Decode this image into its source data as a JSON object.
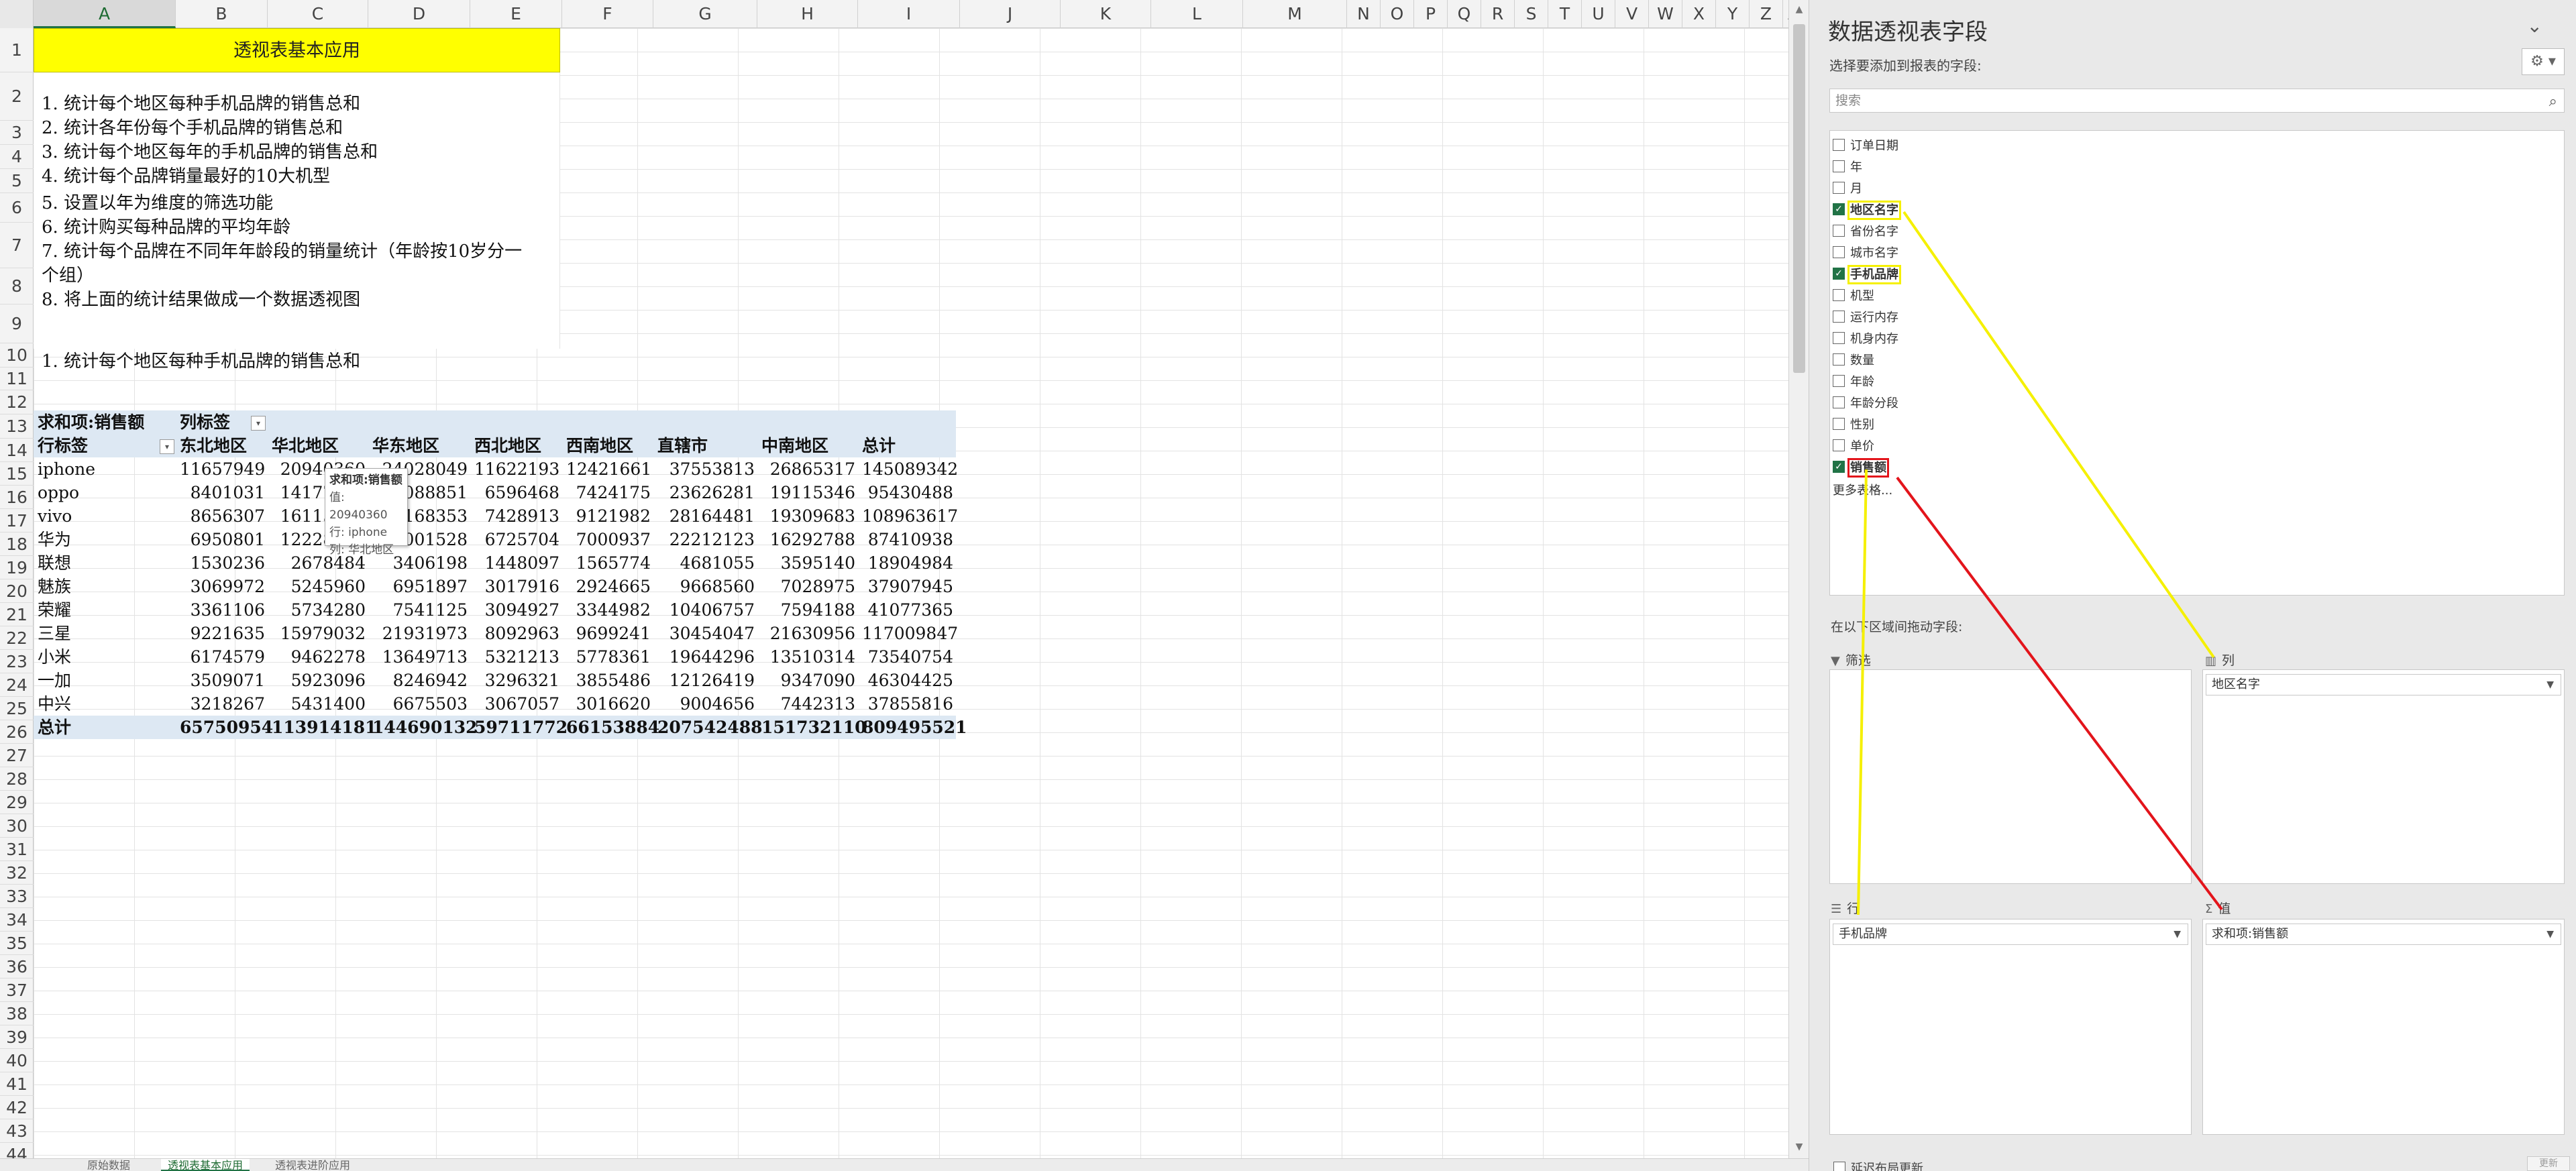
{
  "columns": [
    "A",
    "B",
    "C",
    "D",
    "E",
    "F",
    "G",
    "H",
    "I",
    "J",
    "K",
    "L",
    "M",
    "N",
    "O",
    "P",
    "Q",
    "R",
    "S",
    "T",
    "U",
    "V",
    "W",
    "X",
    "Y",
    "Z",
    "AA"
  ],
  "row_count": 44,
  "sheet": {
    "title": "透视表基本应用",
    "instructions": [
      "1.  统计每个地区每种手机品牌的销售总和",
      "2.  统计各年份每个手机品牌的销售总和",
      "3.  统计每个地区每年的手机品牌的销售总和",
      "4.  统计每个品牌销量最好的10大机型",
      "5.  设置以年为维度的筛选功能",
      "6.  统计购买每种品牌的平均年龄",
      "7.  统计每个品牌在不同年年龄段的销量统计（年龄按10岁分一",
      "个组）",
      "8.  将上面的统计结果做成一个数据透视图"
    ],
    "section_label": "1.  统计每个地区每种手机品牌的销售总和"
  },
  "pivot": {
    "value_label": "求和项:销售额",
    "col_label": "列标签",
    "row_label": "行标签",
    "headers": [
      "东北地区",
      "华北地区",
      "华东地区",
      "西北地区",
      "西南地区",
      "直辖市",
      "中南地区",
      "总计"
    ],
    "rows": [
      {
        "brand": "iphone",
        "values": [
          "11657949",
          "20940360",
          "24028049",
          "11622193",
          "12421661",
          "37553813",
          "26865317",
          "145089342"
        ]
      },
      {
        "brand": "oppo",
        "values": [
          "8401031",
          "14177032",
          "18088851",
          "6596468",
          "7424175",
          "23626281",
          "19115346",
          "95430488"
        ]
      },
      {
        "brand": "vivo",
        "values": [
          "8656307",
          "16115689",
          "18168353",
          "7428913",
          "9121982",
          "28164481",
          "19309683",
          "108963617"
        ]
      },
      {
        "brand": "华为",
        "values": [
          "6950801",
          "12228877",
          "16001528",
          "6725704",
          "7000937",
          "22212123",
          "16292788",
          "87410938"
        ]
      },
      {
        "brand": "联想",
        "values": [
          "1530236",
          "2678484",
          "3406198",
          "1448097",
          "1565774",
          "4681055",
          "3595140",
          "18904984"
        ]
      },
      {
        "brand": "魅族",
        "values": [
          "3069972",
          "5245960",
          "6951897",
          "3017916",
          "2924665",
          "9668560",
          "7028975",
          "37907945"
        ]
      },
      {
        "brand": "荣耀",
        "values": [
          "3361106",
          "5734280",
          "7541125",
          "3094927",
          "3344982",
          "10406757",
          "7594188",
          "41077365"
        ]
      },
      {
        "brand": "三星",
        "values": [
          "9221635",
          "15979032",
          "21931973",
          "8092963",
          "9699241",
          "30454047",
          "21630956",
          "117009847"
        ]
      },
      {
        "brand": "小米",
        "values": [
          "6174579",
          "9462278",
          "13649713",
          "5321213",
          "5778361",
          "19644296",
          "13510314",
          "73540754"
        ]
      },
      {
        "brand": "一加",
        "values": [
          "3509071",
          "5923096",
          "8246942",
          "3296321",
          "3855486",
          "12126419",
          "9347090",
          "46304425"
        ]
      },
      {
        "brand": "中兴",
        "values": [
          "3218267",
          "5431400",
          "6675503",
          "3067057",
          "3016620",
          "9004656",
          "7442313",
          "37855816"
        ]
      }
    ],
    "total_label": "总计",
    "totals": [
      "65750954",
      "113914181",
      "144690132",
      "59711772",
      "66153884",
      "207542488",
      "151732110",
      "809495521"
    ]
  },
  "tooltip": {
    "title": "求和项:销售额",
    "value": "值: 20940360",
    "row": "行: iphone",
    "col": "列: 华北地区"
  },
  "tabs": [
    "原始数据",
    "透视表基本应用",
    "透视表进阶应用"
  ],
  "pane": {
    "title": "数据透视表字段",
    "subtitle": "选择要添加到报表的字段:",
    "search_placeholder": "搜索",
    "fields": [
      {
        "label": "订单日期",
        "checked": false
      },
      {
        "label": "年",
        "checked": false
      },
      {
        "label": "月",
        "checked": false
      },
      {
        "label": "地区名字",
        "checked": true
      },
      {
        "label": "省份名字",
        "checked": false
      },
      {
        "label": "城市名字",
        "checked": false
      },
      {
        "label": "手机品牌",
        "checked": true
      },
      {
        "label": "机型",
        "checked": false
      },
      {
        "label": "运行内存",
        "checked": false
      },
      {
        "label": "机身内存",
        "checked": false
      },
      {
        "label": "数量",
        "checked": false
      },
      {
        "label": "年龄",
        "checked": false
      },
      {
        "label": "年龄分段",
        "checked": false
      },
      {
        "label": "性别",
        "checked": false
      },
      {
        "label": "单价",
        "checked": false
      },
      {
        "label": "销售额",
        "checked": true
      }
    ],
    "more_tables": "更多表格...",
    "drag_hint": "在以下区域间拖动字段:",
    "filter_label": "筛选",
    "columns_label": "列",
    "rows_label": "行",
    "values_label": "值",
    "columns_item": "地区名字",
    "rows_item": "手机品牌",
    "values_item": "求和项:销售额",
    "defer_label": "延迟布局更新",
    "update_label": "更新"
  },
  "colors": {
    "title_fill": "#ffff00",
    "pivot_header_fill": "#dde8f3",
    "annotation_yellow": "#f5f000",
    "annotation_red": "#e3141b",
    "accent": "#217346"
  }
}
